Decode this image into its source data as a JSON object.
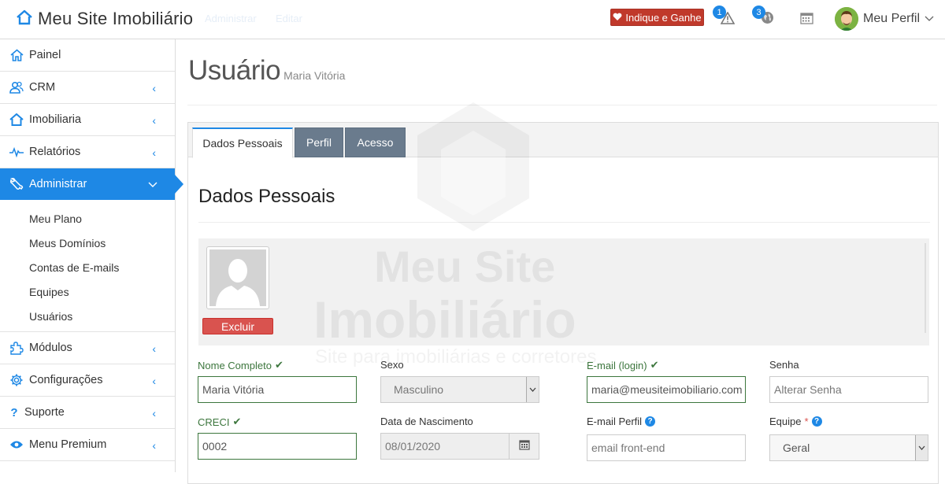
{
  "header": {
    "brand": "Meu Site Imobiliário",
    "breadcrumb": [
      "Administrar",
      "Editar"
    ],
    "referral_button": "Indique e Ganhe",
    "alerts_count": "1",
    "sites_count": "3",
    "profile_label": "Meu Perfil"
  },
  "sidebar": {
    "items": [
      {
        "label": "Painel",
        "icon": "home-icon"
      },
      {
        "label": "CRM",
        "icon": "users-icon"
      },
      {
        "label": "Imobiliaria",
        "icon": "home-icon"
      },
      {
        "label": "Relatórios",
        "icon": "pulse-icon"
      },
      {
        "label": "Administrar",
        "icon": "wrench-icon",
        "active": true
      },
      {
        "label": "Módulos",
        "icon": "puzzle-icon"
      },
      {
        "label": "Configurações",
        "icon": "gear-icon"
      },
      {
        "label": "Suporte",
        "icon": "question-icon"
      },
      {
        "label": "Menu Premium",
        "icon": "eye-icon"
      }
    ],
    "submenu": [
      "Meu Plano",
      "Meus Domínios",
      "Contas de E-mails",
      "Equipes",
      "Usuários"
    ]
  },
  "page": {
    "title": "Usuário",
    "subtitle": "Maria Vitória"
  },
  "watermark": {
    "line1": "Meu Site",
    "line2": "Imobiliário",
    "line3": "Site para imobiliárias e corretores"
  },
  "tabs": [
    "Dados Pessoais",
    "Perfil",
    "Acesso"
  ],
  "section": {
    "title": "Dados Pessoais",
    "delete_photo": "Excluir"
  },
  "form": {
    "nome": {
      "label": "Nome Completo",
      "value": "Maria Vitória"
    },
    "sexo": {
      "label": "Sexo",
      "value": "Masculino"
    },
    "email": {
      "label": "E-mail (login)",
      "value": "maria@meusiteimobiliario.com"
    },
    "senha": {
      "label": "Senha",
      "placeholder": "Alterar Senha"
    },
    "creci": {
      "label": "CRECI",
      "value": "0002"
    },
    "nascimento": {
      "label": "Data de Nascimento",
      "value": "08/01/2020"
    },
    "email_perfil": {
      "label": "E-mail Perfil",
      "placeholder": "email front-end"
    },
    "equipe": {
      "label": "Equipe",
      "required_mark": "*",
      "value": "Geral"
    }
  },
  "colors": {
    "primary": "#1e88e5",
    "danger": "#d9534f",
    "success": "#3c763d",
    "tab_inactive": "#6a7b8d"
  }
}
